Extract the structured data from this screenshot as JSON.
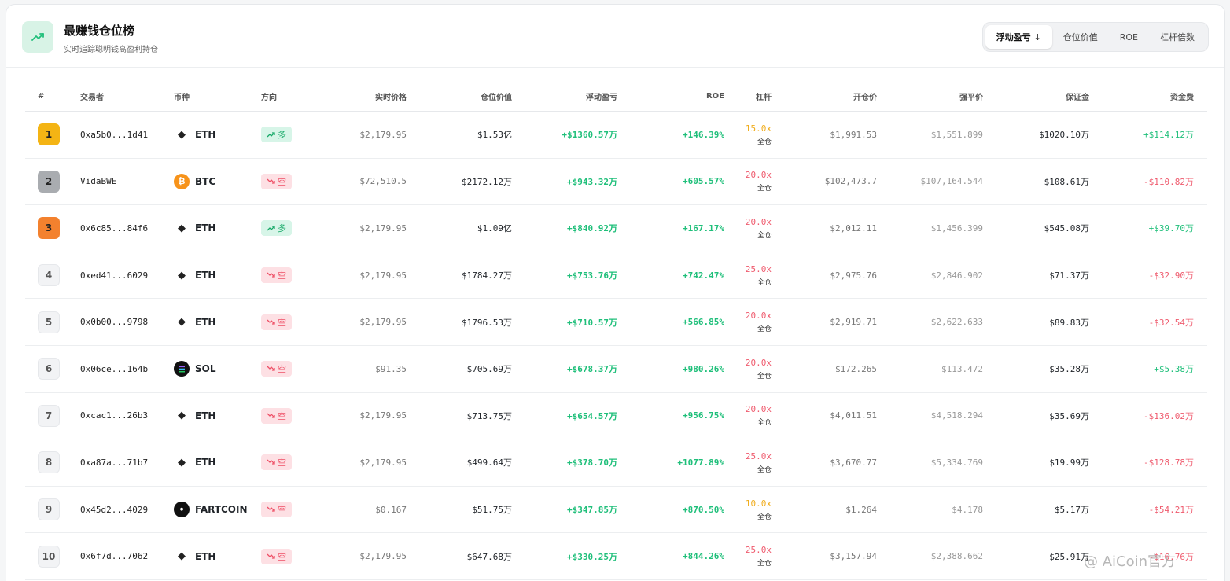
{
  "header": {
    "title": "最赚钱仓位榜",
    "subtitle": "实时追踪聪明钱高盈利持仓",
    "tabs": [
      {
        "label": "浮动盈亏 ↓",
        "active": true
      },
      {
        "label": "仓位价值",
        "active": false
      },
      {
        "label": "ROE",
        "active": false
      },
      {
        "label": "杠杆倍数",
        "active": false
      }
    ]
  },
  "columns": {
    "rank": "#",
    "trader": "交易者",
    "coin": "币种",
    "direction": "方向",
    "price": "实时价格",
    "value": "仓位价值",
    "pnl": "浮动盈亏",
    "roe": "ROE",
    "leverage": "杠杆",
    "entry": "开仓价",
    "liq": "强平价",
    "margin": "保证金",
    "funding": "资金费"
  },
  "rows": [
    {
      "rank": "1",
      "trader": "0xa5b0...1d41",
      "coin": "ETH",
      "icon": "eth-icon",
      "direction": "多",
      "side": "long",
      "price": "$2,179.95",
      "value": "$1.53亿",
      "pnl": "+$1360.57万",
      "roe": "+146.39%",
      "leverage": "15.0x",
      "mode": "全仓",
      "entry": "$1,991.53",
      "liq": "$1,551.899",
      "margin": "$1020.10万",
      "funding": "+$114.12万"
    },
    {
      "rank": "2",
      "trader": "VidaBWE",
      "coin": "BTC",
      "icon": "btc-icon",
      "direction": "空",
      "side": "short",
      "price": "$72,510.5",
      "value": "$2172.12万",
      "pnl": "+$943.32万",
      "roe": "+605.57%",
      "leverage": "20.0x",
      "mode": "全仓",
      "entry": "$102,473.7",
      "liq": "$107,164.544",
      "margin": "$108.61万",
      "funding": "-$110.82万"
    },
    {
      "rank": "3",
      "trader": "0x6c85...84f6",
      "coin": "ETH",
      "icon": "eth-icon",
      "direction": "多",
      "side": "long",
      "price": "$2,179.95",
      "value": "$1.09亿",
      "pnl": "+$840.92万",
      "roe": "+167.17%",
      "leverage": "20.0x",
      "mode": "全仓",
      "entry": "$2,012.11",
      "liq": "$1,456.399",
      "margin": "$545.08万",
      "funding": "+$39.70万"
    },
    {
      "rank": "4",
      "trader": "0xed41...6029",
      "coin": "ETH",
      "icon": "eth-icon",
      "direction": "空",
      "side": "short",
      "price": "$2,179.95",
      "value": "$1784.27万",
      "pnl": "+$753.76万",
      "roe": "+742.47%",
      "leverage": "25.0x",
      "mode": "全仓",
      "entry": "$2,975.76",
      "liq": "$2,846.902",
      "margin": "$71.37万",
      "funding": "-$32.90万"
    },
    {
      "rank": "5",
      "trader": "0x0b00...9798",
      "coin": "ETH",
      "icon": "eth-icon",
      "direction": "空",
      "side": "short",
      "price": "$2,179.95",
      "value": "$1796.53万",
      "pnl": "+$710.57万",
      "roe": "+566.85%",
      "leverage": "20.0x",
      "mode": "全仓",
      "entry": "$2,919.71",
      "liq": "$2,622.633",
      "margin": "$89.83万",
      "funding": "-$32.54万"
    },
    {
      "rank": "6",
      "trader": "0x06ce...164b",
      "coin": "SOL",
      "icon": "sol-icon",
      "direction": "空",
      "side": "short",
      "price": "$91.35",
      "value": "$705.69万",
      "pnl": "+$678.37万",
      "roe": "+980.26%",
      "leverage": "20.0x",
      "mode": "全仓",
      "entry": "$172.265",
      "liq": "$113.472",
      "margin": "$35.28万",
      "funding": "+$5.38万"
    },
    {
      "rank": "7",
      "trader": "0xcac1...26b3",
      "coin": "ETH",
      "icon": "eth-icon",
      "direction": "空",
      "side": "short",
      "price": "$2,179.95",
      "value": "$713.75万",
      "pnl": "+$654.57万",
      "roe": "+956.75%",
      "leverage": "20.0x",
      "mode": "全仓",
      "entry": "$4,011.51",
      "liq": "$4,518.294",
      "margin": "$35.69万",
      "funding": "-$136.02万"
    },
    {
      "rank": "8",
      "trader": "0xa87a...71b7",
      "coin": "ETH",
      "icon": "eth-icon",
      "direction": "空",
      "side": "short",
      "price": "$2,179.95",
      "value": "$499.64万",
      "pnl": "+$378.70万",
      "roe": "+1077.89%",
      "leverage": "25.0x",
      "mode": "全仓",
      "entry": "$3,670.77",
      "liq": "$5,334.769",
      "margin": "$19.99万",
      "funding": "-$128.78万"
    },
    {
      "rank": "9",
      "trader": "0x45d2...4029",
      "coin": "FARTCOIN",
      "icon": "fartcoin-icon",
      "direction": "空",
      "side": "short",
      "price": "$0.167",
      "value": "$51.75万",
      "pnl": "+$347.85万",
      "roe": "+870.50%",
      "leverage": "10.0x",
      "mode": "全仓",
      "entry": "$1.264",
      "liq": "$4.178",
      "margin": "$5.17万",
      "funding": "-$54.21万"
    },
    {
      "rank": "10",
      "trader": "0x6f7d...7062",
      "coin": "ETH",
      "icon": "eth-icon",
      "direction": "空",
      "side": "short",
      "price": "$2,179.95",
      "value": "$647.68万",
      "pnl": "+$330.25万",
      "roe": "+844.26%",
      "leverage": "25.0x",
      "mode": "全仓",
      "entry": "$3,157.94",
      "liq": "$2,388.662",
      "margin": "$25.91万",
      "funding": "-$16.76万"
    }
  ],
  "watermark": "@ AiCoin官方",
  "colors": {
    "positive": "#1fbf7a",
    "negative": "#ef5b6e",
    "leverage_low": "#f0ad1e"
  }
}
